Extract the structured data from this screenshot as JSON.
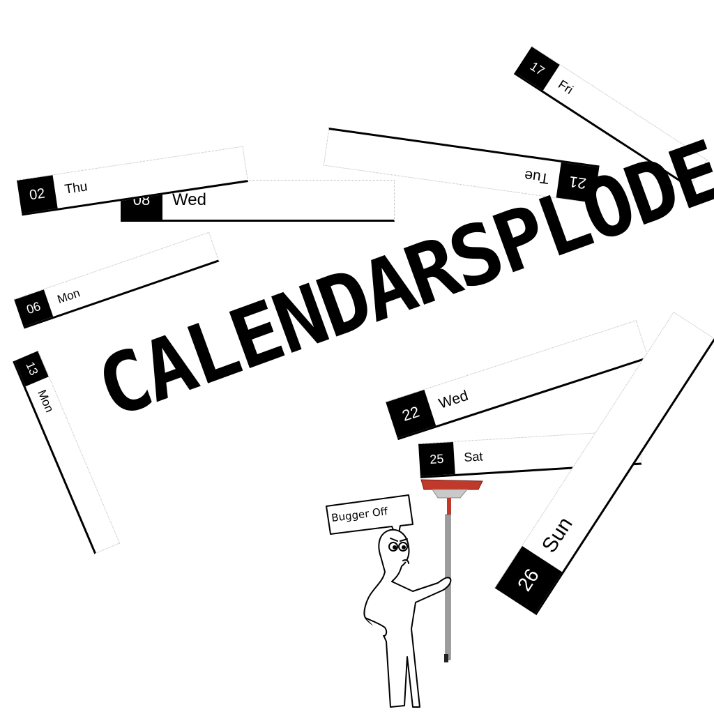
{
  "title": "CALENDARSPLODE!",
  "speech_bubble": "Bugger Off",
  "days": [
    {
      "number": "02",
      "name": "Thu"
    },
    {
      "number": "08",
      "name": "Wed"
    },
    {
      "number": "21",
      "name": "Tue"
    },
    {
      "number": "17",
      "name": "Fri"
    },
    {
      "number": "06",
      "name": "Mon"
    },
    {
      "number": "13",
      "name": "Mon"
    },
    {
      "number": "22",
      "name": "Wed"
    },
    {
      "number": "25",
      "name": "Sat"
    },
    {
      "number": "26",
      "name": "Sun"
    }
  ],
  "colors": {
    "tile_number_bg": "#000000",
    "broom_head": "#c0392b",
    "broom_handle": "#9e9e9e"
  }
}
